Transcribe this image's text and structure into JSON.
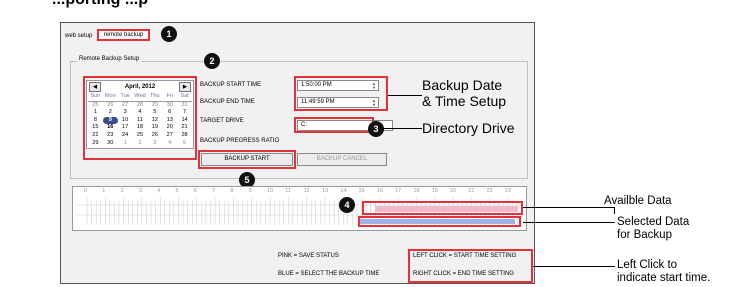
{
  "page_header": "...porting ...p",
  "tabs": {
    "web_setup": "web setup",
    "remote_backup": "remote backup"
  },
  "group_title": "Remote Backup Setup",
  "calendar": {
    "month_label": "April, 2012",
    "prev_symbol": "◀",
    "next_symbol": "▶",
    "weekdays": [
      "Sun",
      "Mon",
      "Tue",
      "Wed",
      "Thu",
      "Fri",
      "Sat"
    ],
    "days": [
      {
        "d": "25",
        "s": "other"
      },
      {
        "d": "26",
        "s": "other"
      },
      {
        "d": "27",
        "s": "other"
      },
      {
        "d": "28",
        "s": "other"
      },
      {
        "d": "29",
        "s": "other"
      },
      {
        "d": "30",
        "s": "other"
      },
      {
        "d": "31",
        "s": "other"
      },
      {
        "d": "1",
        "s": ""
      },
      {
        "d": "2",
        "s": ""
      },
      {
        "d": "3",
        "s": ""
      },
      {
        "d": "4",
        "s": ""
      },
      {
        "d": "5",
        "s": ""
      },
      {
        "d": "6",
        "s": ""
      },
      {
        "d": "7",
        "s": ""
      },
      {
        "d": "8",
        "s": ""
      },
      {
        "d": "9",
        "s": "today"
      },
      {
        "d": "10",
        "s": ""
      },
      {
        "d": "11",
        "s": ""
      },
      {
        "d": "12",
        "s": ""
      },
      {
        "d": "13",
        "s": ""
      },
      {
        "d": "14",
        "s": ""
      },
      {
        "d": "15",
        "s": ""
      },
      {
        "d": "16",
        "s": "bold"
      },
      {
        "d": "17",
        "s": ""
      },
      {
        "d": "18",
        "s": ""
      },
      {
        "d": "19",
        "s": ""
      },
      {
        "d": "20",
        "s": ""
      },
      {
        "d": "21",
        "s": ""
      },
      {
        "d": "22",
        "s": ""
      },
      {
        "d": "23",
        "s": ""
      },
      {
        "d": "24",
        "s": ""
      },
      {
        "d": "25",
        "s": ""
      },
      {
        "d": "26",
        "s": ""
      },
      {
        "d": "27",
        "s": ""
      },
      {
        "d": "28",
        "s": ""
      },
      {
        "d": "29",
        "s": ""
      },
      {
        "d": "30",
        "s": ""
      },
      {
        "d": "1",
        "s": "other"
      },
      {
        "d": "2",
        "s": "other"
      },
      {
        "d": "3",
        "s": "other"
      },
      {
        "d": "4",
        "s": "other"
      },
      {
        "d": "5",
        "s": "other"
      }
    ]
  },
  "fields": {
    "start_label": "BACKUP START TIME",
    "start_value": "1:50:00 PM",
    "end_label": "BACKUP END TIME",
    "end_value": "11:49:59 PM",
    "target_label": "TARGET DRIVE",
    "target_value": "C:",
    "progress_label": "BACKUP PREGRESS RATIO"
  },
  "buttons": {
    "start": "BACKUP START",
    "cancel": "BACKUP CANCEL"
  },
  "timeline_hours": [
    "0",
    "1",
    "2",
    "3",
    "4",
    "5",
    "6",
    "7",
    "8",
    "9",
    "10",
    "11",
    "12",
    "13",
    "14",
    "15",
    "16",
    "17",
    "18",
    "19",
    "20",
    "21",
    "22",
    "23"
  ],
  "legend": {
    "pink": "PINK = SAVE STATUS",
    "blue": "BLUE = SELECT THE BACKUP TIME",
    "left_click": "LEFT CLICK = START TIME SETTING",
    "right_click": "RIGHT CLICK = END TIME SETTING"
  },
  "badges": [
    "1",
    "2",
    "3",
    "4",
    "5"
  ],
  "annotations": {
    "date_time_1": "Backup Date",
    "date_time_2": "& Time Setup",
    "directory": "Directory Drive",
    "avail": "Availble Data",
    "selected_1": "Selected Data",
    "selected_2": "for Backup",
    "left_click_1": "Left Click to",
    "left_click_2": "indicate start time."
  },
  "colors": {
    "highlight": "#e53238",
    "save_status": "#f2b8c8",
    "backup_select": "#9bb6e6",
    "badge": "#111111"
  }
}
